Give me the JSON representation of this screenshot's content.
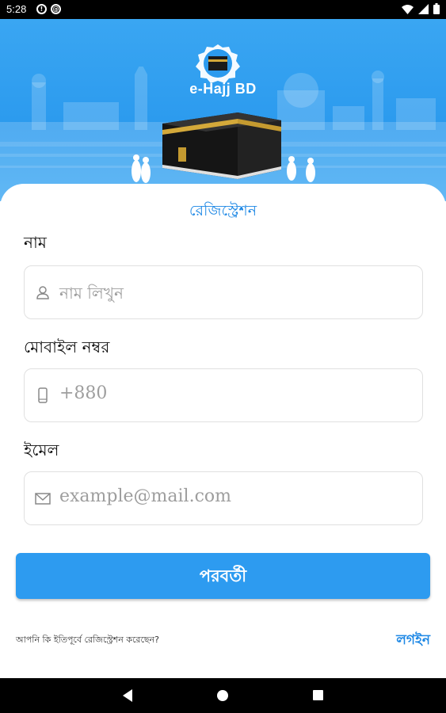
{
  "status_bar": {
    "time": "5:28",
    "left_icons": [
      "sim-icon",
      "vpn-icon"
    ],
    "right_icons": [
      "wifi-icon",
      "signal-icon",
      "battery-icon"
    ]
  },
  "hero": {
    "brand": "e-Hajj BD",
    "logo": "kaaba-logo-icon"
  },
  "form": {
    "title": "রেজিস্ট্রেশন",
    "name_label": "নাম",
    "name_placeholder": "নাম লিখুন",
    "mobile_label": "মোবাইল নম্বর",
    "mobile_placeholder": "+880",
    "email_label": "ইমেল",
    "email_placeholder": "example@mail.com",
    "next_button": "পরবর্তী",
    "already_registered": "আপনি কি ইতিপূর্বে রেজিস্ট্রেশন করেছেন?",
    "login_link": "লগইন"
  },
  "colors": {
    "primary": "#2d9bf0",
    "accent_text": "#1e88e5",
    "hero_bg": "#3aa6f2"
  },
  "nav_bar": {
    "buttons": [
      "back-icon",
      "home-icon",
      "recents-icon"
    ]
  }
}
